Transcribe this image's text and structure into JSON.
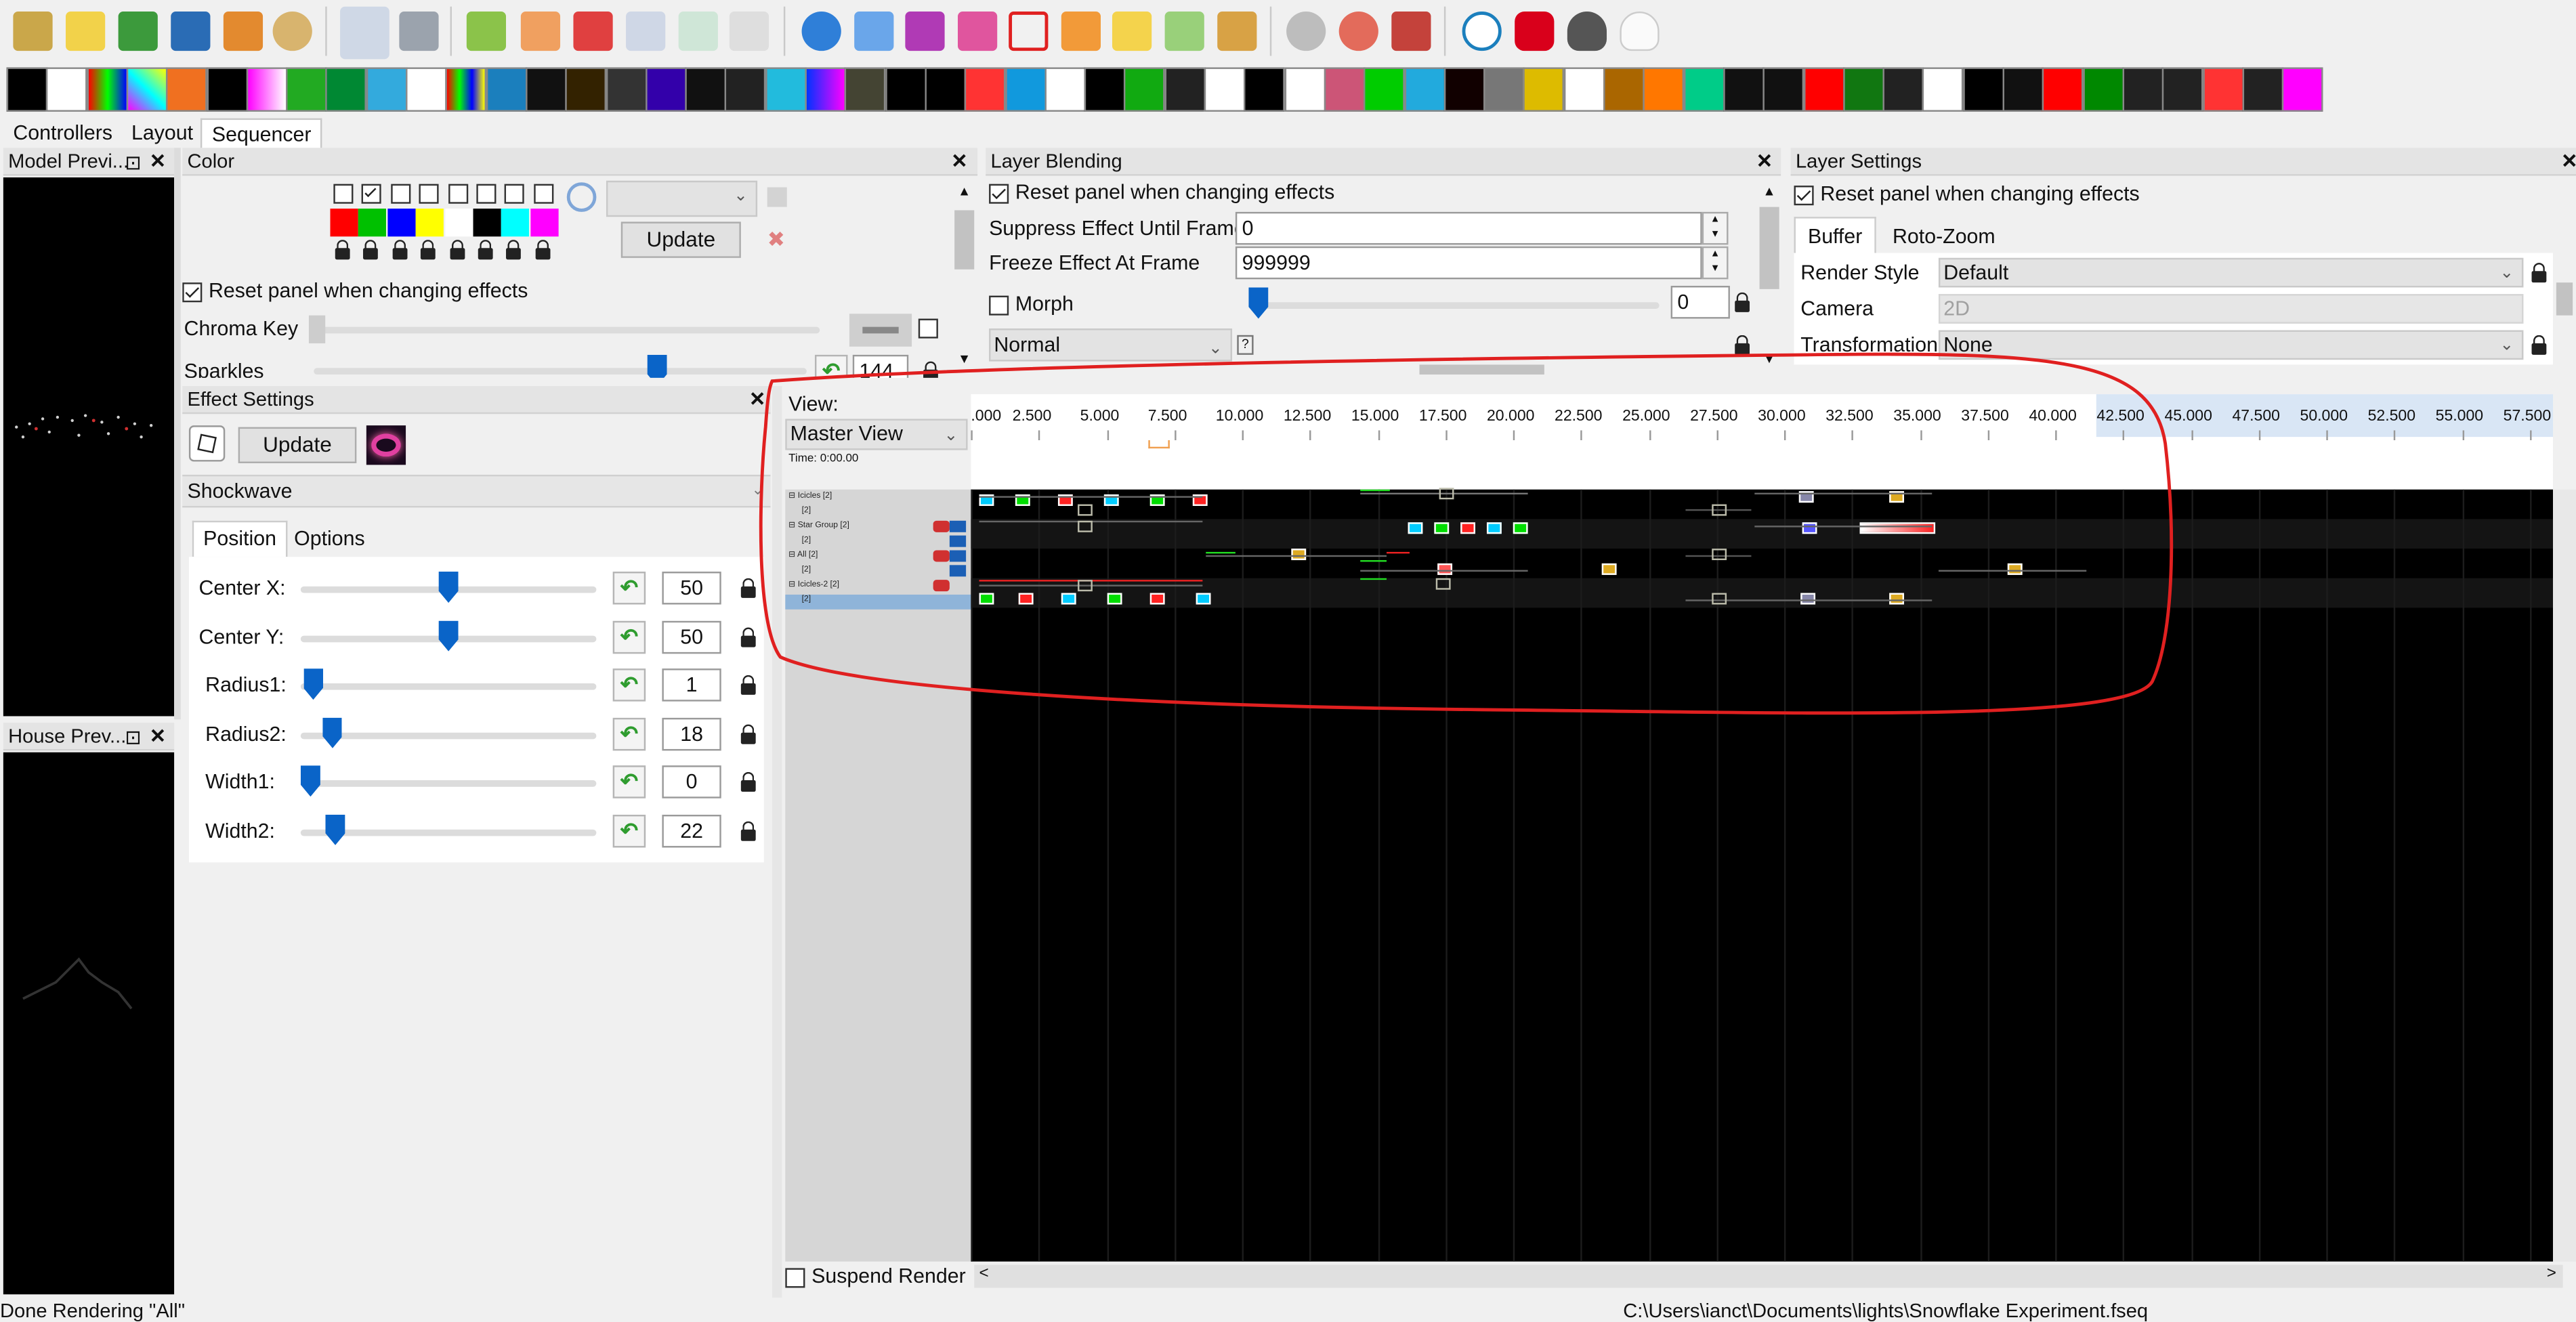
{
  "tabs": {
    "controllers": "Controllers",
    "layout": "Layout",
    "sequencer": "Sequencer"
  },
  "panels": {
    "model_preview": "Model Previ...",
    "house_preview": "House Prev...",
    "color": {
      "title": "Color",
      "update": "Update",
      "reset_label": "Reset panel when changing effects",
      "chroma_key": "Chroma Key",
      "sparkles": "Sparkles",
      "sparkles_value": "144",
      "palette": [
        "#ff0000",
        "#00c000",
        "#0000ff",
        "#ffff00",
        "#ffffff",
        "#000000",
        "#00ffff",
        "#ff00ff"
      ]
    },
    "layer_blending": {
      "title": "Layer Blending",
      "reset_label": "Reset panel when changing effects",
      "suppress_label": "Suppress Effect Until Frame",
      "suppress_value": "0",
      "freeze_label": "Freeze Effect At Frame",
      "freeze_value": "999999",
      "morph": "Morph",
      "morph_value": "0",
      "mode": "Normal",
      "help": "?"
    },
    "layer_settings": {
      "title": "Layer Settings",
      "reset_label": "Reset panel when changing effects",
      "tab_buffer": "Buffer",
      "tab_roto": "Roto-Zoom",
      "render_style_label": "Render Style",
      "render_style": "Default",
      "camera_label": "Camera",
      "camera": "2D",
      "transformation_label": "Transformation",
      "transformation": "None"
    },
    "effect_settings": {
      "title": "Effect Settings",
      "update": "Update",
      "effect_name": "Shockwave",
      "tab_position": "Position",
      "tab_options": "Options",
      "params": [
        {
          "label": "Center X:",
          "value": "50",
          "pos": 50
        },
        {
          "label": "Center Y:",
          "value": "50",
          "pos": 50
        },
        {
          "label": "Radius1:",
          "value": "1",
          "pos": 1
        },
        {
          "label": "Radius2:",
          "value": "18",
          "pos": 8
        },
        {
          "label": "Width1:",
          "value": "0",
          "pos": 0
        },
        {
          "label": "Width2:",
          "value": "22",
          "pos": 9
        }
      ]
    }
  },
  "sequencer": {
    "view_label": "View:",
    "view_value": "Master View",
    "time": "Time: 0:00.00",
    "ticks": [
      ".000",
      "2.500",
      "5.000",
      "7.500",
      "10.000",
      "12.500",
      "15.000",
      "17.500",
      "20.000",
      "22.500",
      "25.000",
      "27.500",
      "30.000",
      "32.500",
      "35.000",
      "37.500",
      "40.000",
      "42.500",
      "45.000",
      "47.500",
      "50.000",
      "52.500",
      "55.000",
      "57.500"
    ],
    "rows": [
      "Icicles [2]",
      "[2]",
      "Star Group [2]",
      "[2]",
      "All [2]",
      "[2]",
      "Icicles-2 [2]",
      "[2]"
    ],
    "suspend_render": "Suspend Render"
  },
  "status": {
    "left": "Done Rendering \"All\"",
    "right": "C:\\Users\\ianct\\Documents\\lights\\Snowflake Experiment.fseq"
  },
  "colors": {
    "accent": "#0a64c8",
    "highlight": "#e02020"
  }
}
